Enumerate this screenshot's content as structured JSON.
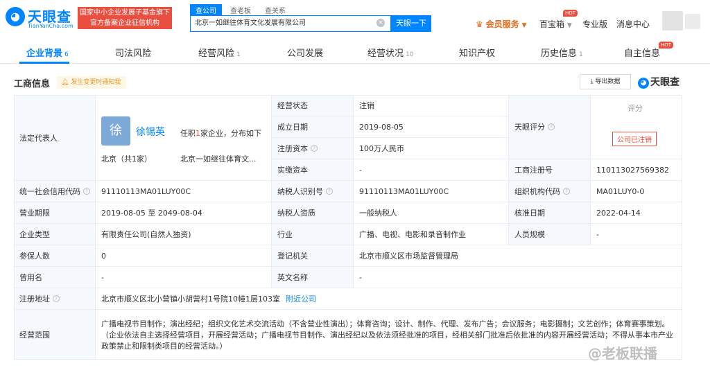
{
  "header": {
    "logo_text": "天眼查",
    "logo_sub": "TianYanCha.com",
    "banner_line1": "国家中小企业发展子基金旗下",
    "banner_line2": "官方备案企业征信机构",
    "search_tabs": [
      "查公司",
      "查老板",
      "查关系"
    ],
    "search_value": "北京一如继往体育文化发展有限公司",
    "search_button": "天眼一下",
    "vip_label": "会员服务",
    "baobao": "百宝箱",
    "hot": "HOT",
    "pro": "专业版",
    "messages": "消息中心"
  },
  "tabs": [
    {
      "label": "企业背景",
      "count": "6"
    },
    {
      "label": "司法风险",
      "count": ""
    },
    {
      "label": "经营风险",
      "count": "1"
    },
    {
      "label": "公司发展",
      "count": ""
    },
    {
      "label": "经营状况",
      "count": "10"
    },
    {
      "label": "知识产权",
      "count": ""
    },
    {
      "label": "历史信息",
      "count": "1"
    },
    {
      "label": "自主信息",
      "count": ""
    }
  ],
  "section": {
    "title": "工商信息",
    "notify": "发生变更时通知我",
    "export": "导出数据",
    "brand": "天眼查"
  },
  "legal_rep": {
    "label": "法定代表人",
    "avatar_char": "徐",
    "name": "徐锡英",
    "info_prefix": "任职",
    "info_num": "1",
    "info_suffix": "家企业，分布如下",
    "location": "北京（共1家）",
    "company": "北京一如继往体育文..."
  },
  "fields": {
    "status_label": "经营状态",
    "status_value": "注销",
    "established_label": "成立日期",
    "established_value": "2019-08-05",
    "capital_label": "注册资本",
    "capital_value": "100万人民币",
    "paid_label": "实缴资本",
    "paid_value": "-",
    "score_label": "天眼评分",
    "score_title": "评分",
    "score_stamp": "公司已注销",
    "regno_label": "工商注册号",
    "regno_value": "110113027569382",
    "credit_label": "统一社会信用代码",
    "credit_value": "91110113MA01LUY00C",
    "taxid_label": "纳税人识别号",
    "taxid_value": "91110113MA01LUY00C",
    "org_label": "组织机构代码",
    "org_value": "MA01LUY0-0",
    "term_label": "营业期限",
    "term_value": "2019-08-05 至 2049-08-04",
    "taxqual_label": "纳税人资质",
    "taxqual_value": "一般纳税人",
    "approve_label": "核准日期",
    "approve_value": "2022-04-14",
    "type_label": "企业类型",
    "type_value": "有限责任公司(自然人独资)",
    "industry_label": "行业",
    "industry_value": "广播、电视、电影和录音制作业",
    "staff_label": "人员规模",
    "staff_value": "-",
    "insured_label": "参保人数",
    "insured_value": "0",
    "authority_label": "登记机关",
    "authority_value": "北京市顺义区市场监督管理局",
    "former_label": "曾用名",
    "former_value": "-",
    "english_label": "英文名称",
    "english_value": "-",
    "address_label": "注册地址",
    "address_value": "北京市顺义区北小营镇小胡营村1号院10幢1层103室",
    "address_link": "附近公司",
    "scope_label": "经营范围",
    "scope_value": "广播电视节目制作；演出经纪；组织文化艺术交流活动（不含营业性演出）；体育咨询；设计、制作、代理、发布广告；会议服务；电影摄制；文艺创作；体育赛事策划。（企业依法自主选择经营项目，开展经营活动；广播电视节目制作、演出经纪以及依法须经批准的项目，经相关部门批准后依批准的内容开展经营活动；不得从事本市产业政策禁止和限制类项目的经营活动。）"
  },
  "watermark": "@老板联播"
}
